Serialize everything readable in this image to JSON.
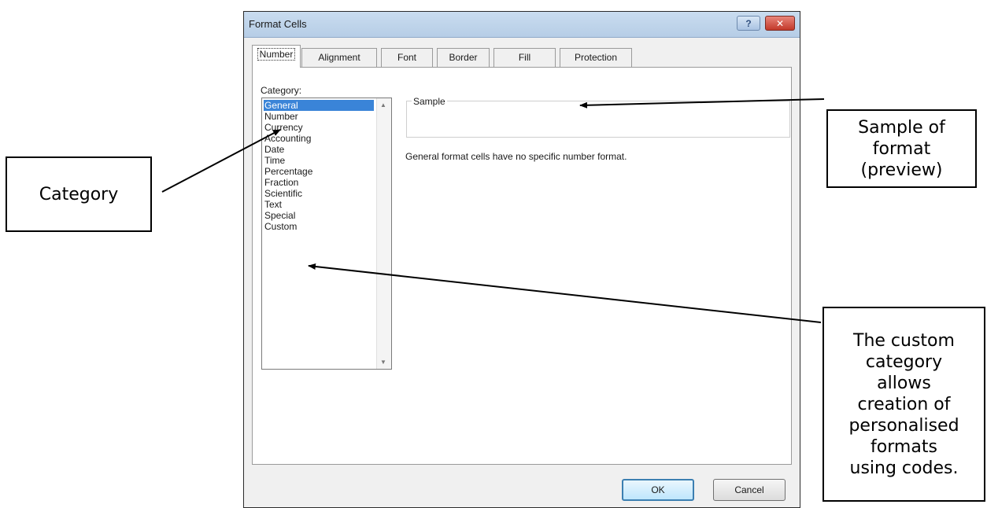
{
  "dialog": {
    "title": "Format Cells",
    "help_label": "?",
    "close_label": "✕",
    "tabs": [
      {
        "label": "Number",
        "active": true
      },
      {
        "label": "Alignment",
        "active": false
      },
      {
        "label": "Font",
        "active": false
      },
      {
        "label": "Border",
        "active": false
      },
      {
        "label": "Fill",
        "active": false
      },
      {
        "label": "Protection",
        "active": false
      }
    ],
    "category_label": "Category:",
    "categories": [
      "General",
      "Number",
      "Currency",
      "Accounting",
      "Date",
      "Time",
      "Percentage",
      "Fraction",
      "Scientific",
      "Text",
      "Special",
      "Custom"
    ],
    "selected_category": "General",
    "sample_label": "Sample",
    "sample_value": "",
    "description": "General format cells have no specific number format.",
    "ok_label": "OK",
    "cancel_label": "Cancel"
  },
  "annotations": {
    "category": "Category",
    "sample": [
      "Sample of",
      "format",
      "(preview)"
    ],
    "custom": [
      "The custom",
      "category",
      "allows",
      "creation of",
      "personalised",
      "formats",
      "using codes."
    ]
  },
  "colors": {
    "selection": "#3a84d8",
    "titlebar": "#c9dcef",
    "close_button": "#c2392a"
  }
}
